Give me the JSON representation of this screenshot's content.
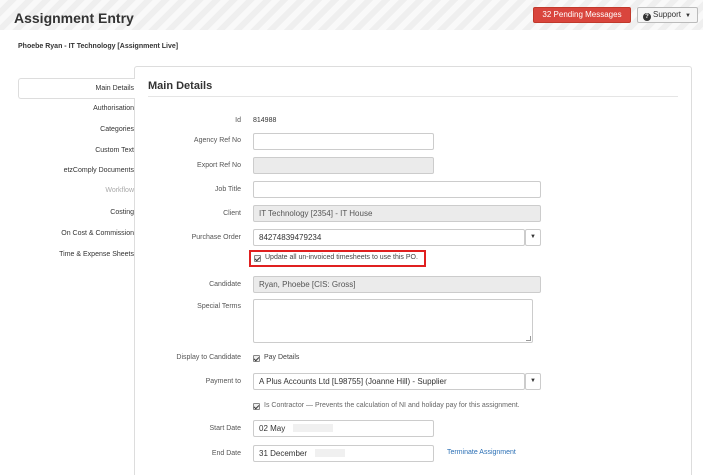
{
  "header": {
    "title": "Assignment Entry",
    "pending_messages": "32 Pending Messages",
    "support_label": "Support"
  },
  "breadcrumb": "Phoebe Ryan - IT Technology [Assignment Live]",
  "sidebar": {
    "items": [
      {
        "label": "Main Details",
        "active": true
      },
      {
        "label": "Authorisation"
      },
      {
        "label": "Categories"
      },
      {
        "label": "Custom Text"
      },
      {
        "label": "etzComply Documents"
      },
      {
        "label": "Workflow",
        "disabled": true
      },
      {
        "label": "Costing"
      },
      {
        "label": "On Cost & Commission"
      },
      {
        "label": "Time & Expense Sheets"
      }
    ]
  },
  "main": {
    "section_title": "Main Details",
    "fields": {
      "id": {
        "label": "Id",
        "value": "814988"
      },
      "agency_ref": {
        "label": "Agency Ref No",
        "value": ""
      },
      "export_ref": {
        "label": "Export Ref No",
        "value": ""
      },
      "job_title": {
        "label": "Job Title",
        "value": ""
      },
      "client": {
        "label": "Client",
        "value": "IT Technology  [2354] - IT House"
      },
      "purchase_order": {
        "label": "Purchase Order",
        "value": "84274839479234"
      },
      "update_timesheets": {
        "label": "Update all un-invoiced timesheets to use this PO.",
        "checked": true
      },
      "candidate": {
        "label": "Candidate",
        "value": "Ryan, Phoebe [CIS: Gross]"
      },
      "special_terms": {
        "label": "Special Terms",
        "value": ""
      },
      "display_to_candidate": {
        "label": "Display to Candidate",
        "option": "Pay Details",
        "checked": true
      },
      "payment_to": {
        "label": "Payment to",
        "value": "A Plus Accounts Ltd [L98755] (Joanne Hill) - Supplier"
      },
      "is_contractor": {
        "label": "Is Contractor — Prevents the calculation of NI and holiday pay for this assignment.",
        "checked": true
      },
      "start_date": {
        "label": "Start Date",
        "value": "02 May"
      },
      "end_date": {
        "label": "End Date",
        "value": "31 December"
      }
    },
    "terminate_link": "Terminate Assignment"
  },
  "colors": {
    "pending_bg": "#d9453d",
    "highlight_border": "#e02020",
    "link": "#2a6fb5"
  }
}
